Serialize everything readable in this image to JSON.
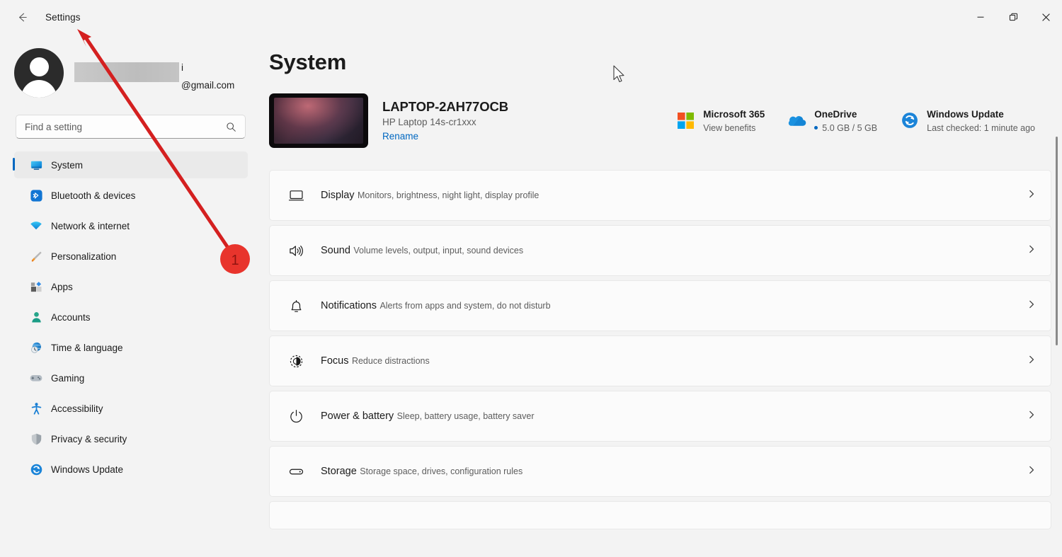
{
  "window": {
    "title": "Settings",
    "back_icon": "back-arrow-icon",
    "controls": [
      {
        "name": "minimize",
        "label": "—"
      },
      {
        "name": "maximize",
        "label": "❐"
      },
      {
        "name": "close",
        "label": "✕"
      }
    ]
  },
  "sidebar": {
    "account": {
      "name_visible_tail": "i",
      "email_suffix": "@gmail.com",
      "avatar_icon": "user-avatar-icon"
    },
    "search": {
      "placeholder": "Find a setting",
      "value": "",
      "icon": "search-icon"
    },
    "items": [
      {
        "label": "System",
        "icon": "monitor-icon",
        "active": true
      },
      {
        "label": "Bluetooth & devices",
        "icon": "bluetooth-icon",
        "active": false
      },
      {
        "label": "Network & internet",
        "icon": "wifi-icon",
        "active": false
      },
      {
        "label": "Personalization",
        "icon": "paintbrush-icon",
        "active": false
      },
      {
        "label": "Apps",
        "icon": "apps-grid-icon",
        "active": false
      },
      {
        "label": "Accounts",
        "icon": "person-icon",
        "active": false
      },
      {
        "label": "Time & language",
        "icon": "clock-globe-icon",
        "active": false
      },
      {
        "label": "Gaming",
        "icon": "gamepad-icon",
        "active": false
      },
      {
        "label": "Accessibility",
        "icon": "accessibility-person-icon",
        "active": false
      },
      {
        "label": "Privacy & security",
        "icon": "shield-icon",
        "active": false
      },
      {
        "label": "Windows Update",
        "icon": "update-refresh-icon",
        "active": false
      }
    ]
  },
  "main": {
    "page_title": "System",
    "device": {
      "name": "LAPTOP-2AH77OCB",
      "model": "HP Laptop 14s-cr1xxx",
      "rename_label": "Rename",
      "thumbnail_icon": "laptop-thumbnail-icon"
    },
    "status_cards": [
      {
        "title": "Microsoft 365",
        "subtitle": "View benefits",
        "icon": "microsoft-logo-icon",
        "has_dot": false
      },
      {
        "title": "OneDrive",
        "subtitle": "5.0 GB / 5 GB",
        "icon": "onedrive-cloud-icon",
        "has_dot": true
      },
      {
        "title": "Windows Update",
        "subtitle": "Last checked: 1 minute ago",
        "icon": "update-refresh-icon",
        "has_dot": false
      }
    ],
    "settings_rows": [
      {
        "title": "Display",
        "subtitle": "Monitors, brightness, night light, display profile",
        "icon": "display-monitor-icon"
      },
      {
        "title": "Sound",
        "subtitle": "Volume levels, output, input, sound devices",
        "icon": "speaker-icon"
      },
      {
        "title": "Notifications",
        "subtitle": "Alerts from apps and system, do not disturb",
        "icon": "bell-icon"
      },
      {
        "title": "Focus",
        "subtitle": "Reduce distractions",
        "icon": "focus-moon-icon"
      },
      {
        "title": "Power & battery",
        "subtitle": "Sleep, battery usage, battery saver",
        "icon": "power-icon"
      },
      {
        "title": "Storage",
        "subtitle": "Storage space, drives, configuration rules",
        "icon": "storage-drive-icon"
      }
    ]
  },
  "annotation": {
    "marker_number": "1",
    "marker_color": "#e8342c",
    "arrow_color": "#d42020"
  },
  "colors": {
    "accent": "#0067c0",
    "page_background": "#f3f3f3",
    "card_background": "#fbfbfb",
    "text_primary": "#1b1b1b",
    "text_secondary": "#5d5d5d"
  }
}
